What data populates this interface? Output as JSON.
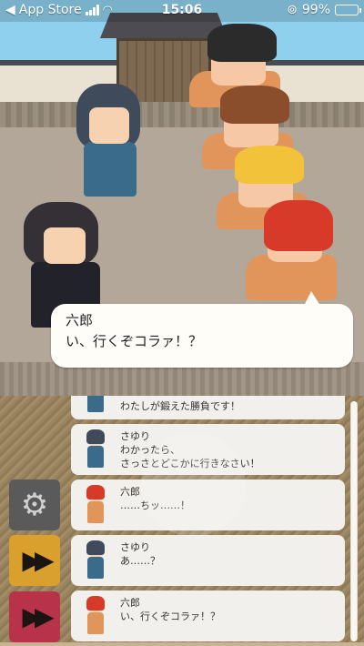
{
  "status_bar": {
    "carrier": "App Store",
    "time": "15:06",
    "battery": "99%"
  },
  "scene": {
    "dialogue": {
      "speaker": "六郎",
      "text": "い、行くぞコラァ！？"
    }
  },
  "log": {
    "entries": [
      {
        "speaker": "",
        "text": "わたしが鍛えた勝負です！",
        "avatar": "sayuri"
      },
      {
        "speaker": "さゆり",
        "text": "わかったら、",
        "text2": "さっさとどこかに行きなさい！",
        "avatar": "sayuri"
      },
      {
        "speaker": "六郎",
        "text": "……ちッ……！",
        "avatar": "rokuro"
      },
      {
        "speaker": "さゆり",
        "text": "あ……？",
        "avatar": "sayuri"
      },
      {
        "speaker": "六郎",
        "text": "い、行くぞコラァ！？",
        "avatar": "rokuro"
      }
    ]
  },
  "buttons": {
    "settings_icon": "gear-icon",
    "skip_icon": "fast-forward-icon",
    "auto_icon": "fast-forward-icon"
  },
  "colors": {
    "settings": "#5a5a5a",
    "skip": "#d9a02d",
    "auto": "#b8324a"
  }
}
